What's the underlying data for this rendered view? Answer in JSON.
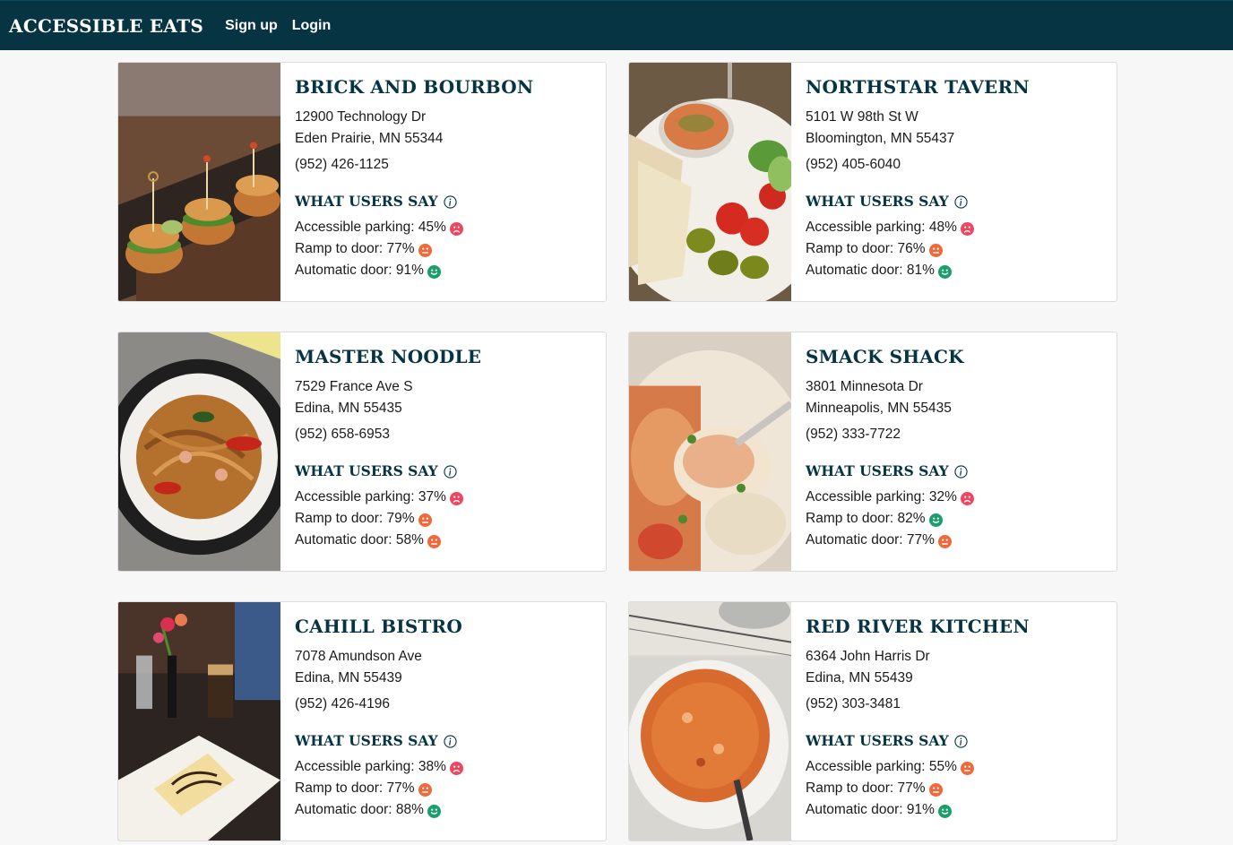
{
  "header": {
    "brand": "ACCESSIBLE EATS",
    "signup": "Sign up",
    "login": "Login"
  },
  "colors": {
    "header_bg": "#063442",
    "title": "#063442",
    "good": "#1a9e6b",
    "neutral": "#ef6a3b",
    "bad": "#f0455f"
  },
  "section_heading": "WHAT USERS SAY",
  "restaurants": [
    {
      "name": "BRICK AND BOURBON",
      "address1": "12900 Technology Dr",
      "address2": "Eden Prairie, MN 55344",
      "phone": "(952) 426-1125",
      "photo": "sliders-burgers-photo",
      "stats": [
        {
          "label": "Accessible parking: 45%",
          "rating": "bad"
        },
        {
          "label": "Ramp to door: 77%",
          "rating": "neutral"
        },
        {
          "label": "Automatic door: 91%",
          "rating": "good"
        }
      ]
    },
    {
      "name": "NORTHSTAR TAVERN",
      "address1": "5101 W 98th St W",
      "address2": "Bloomington, MN 55437",
      "phone": "(952) 405-6040",
      "photo": "hummus-plate-photo",
      "stats": [
        {
          "label": "Accessible parking: 48%",
          "rating": "bad"
        },
        {
          "label": "Ramp to door: 76%",
          "rating": "neutral"
        },
        {
          "label": "Automatic door: 81%",
          "rating": "good"
        }
      ]
    },
    {
      "name": "MASTER NOODLE",
      "address1": "7529 France Ave S",
      "address2": "Edina, MN 55435",
      "phone": "(952) 658-6953",
      "photo": "noodles-photo",
      "stats": [
        {
          "label": "Accessible parking: 37%",
          "rating": "bad"
        },
        {
          "label": "Ramp to door: 79%",
          "rating": "neutral"
        },
        {
          "label": "Automatic door: 58%",
          "rating": "neutral"
        }
      ]
    },
    {
      "name": "SMACK SHACK",
      "address1": "3801 Minnesota Dr",
      "address2": "Minneapolis, MN 55435",
      "phone": "(952) 333-7722",
      "photo": "lobster-mac-photo",
      "stats": [
        {
          "label": "Accessible parking: 32%",
          "rating": "bad"
        },
        {
          "label": "Ramp to door: 82%",
          "rating": "good"
        },
        {
          "label": "Automatic door: 77%",
          "rating": "neutral"
        }
      ]
    },
    {
      "name": "CAHILL BISTRO",
      "address1": "7078 Amundson Ave",
      "address2": "Edina, MN 55439",
      "phone": "(952) 426-4196",
      "photo": "dessert-table-photo",
      "stats": [
        {
          "label": "Accessible parking: 38%",
          "rating": "bad"
        },
        {
          "label": "Ramp to door: 77%",
          "rating": "neutral"
        },
        {
          "label": "Automatic door: 88%",
          "rating": "good"
        }
      ]
    },
    {
      "name": "RED RIVER KITCHEN",
      "address1": "6364 John Harris Dr",
      "address2": "Edina, MN 55439",
      "phone": "(952) 303-3481",
      "photo": "gumbo-bowl-photo",
      "stats": [
        {
          "label": "Accessible parking: 55%",
          "rating": "neutral"
        },
        {
          "label": "Ramp to door: 77%",
          "rating": "neutral"
        },
        {
          "label": "Automatic door: 91%",
          "rating": "good"
        }
      ]
    }
  ]
}
